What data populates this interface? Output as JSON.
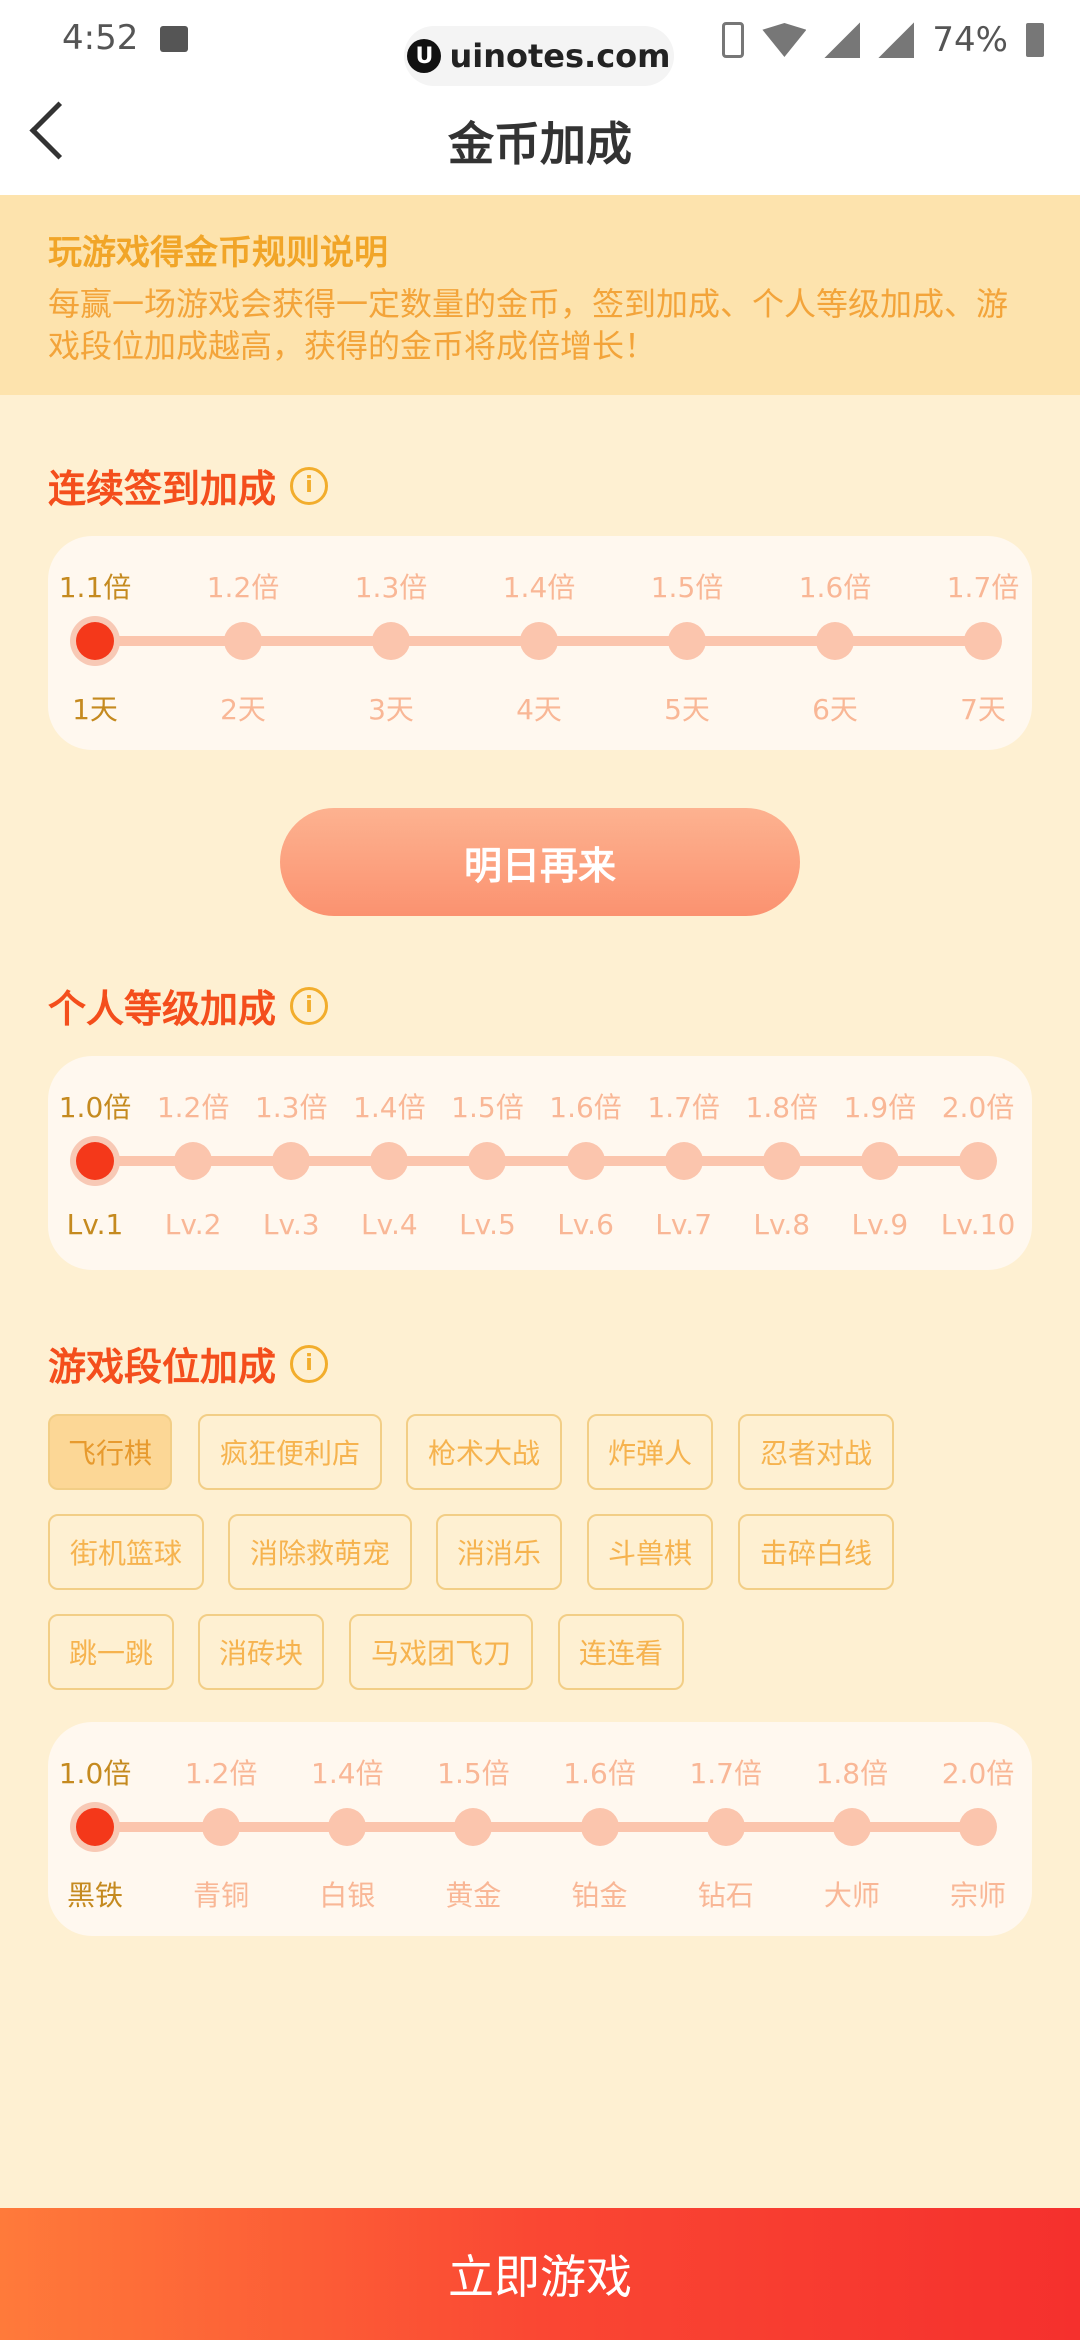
{
  "status": {
    "time": "4:52",
    "battery": "74%",
    "watermark": "uinotes.com",
    "watermark_logo": "U"
  },
  "header": {
    "title": "金币加成"
  },
  "rules": {
    "title": "玩游戏得金币规则说明",
    "text": "每赢一场游戏会获得一定数量的金币，签到加成、个人等级加成、游戏段位加成越高，获得的金币将成倍增长！"
  },
  "checkin": {
    "title": "连续签到加成",
    "info_glyph": "i",
    "active_index": 0,
    "steps": [
      {
        "multiplier": "1.1倍",
        "label": "1天"
      },
      {
        "multiplier": "1.2倍",
        "label": "2天"
      },
      {
        "multiplier": "1.3倍",
        "label": "3天"
      },
      {
        "multiplier": "1.4倍",
        "label": "4天"
      },
      {
        "multiplier": "1.5倍",
        "label": "5天"
      },
      {
        "multiplier": "1.6倍",
        "label": "6天"
      },
      {
        "multiplier": "1.7倍",
        "label": "7天"
      }
    ],
    "button": "明日再来"
  },
  "level": {
    "title": "个人等级加成",
    "info_glyph": "i",
    "active_index": 0,
    "steps": [
      {
        "multiplier": "1.0倍",
        "label": "Lv.1"
      },
      {
        "multiplier": "1.2倍",
        "label": "Lv.2"
      },
      {
        "multiplier": "1.3倍",
        "label": "Lv.3"
      },
      {
        "multiplier": "1.4倍",
        "label": "Lv.4"
      },
      {
        "multiplier": "1.5倍",
        "label": "Lv.5"
      },
      {
        "multiplier": "1.6倍",
        "label": "Lv.6"
      },
      {
        "multiplier": "1.7倍",
        "label": "Lv.7"
      },
      {
        "multiplier": "1.8倍",
        "label": "Lv.8"
      },
      {
        "multiplier": "1.9倍",
        "label": "Lv.9"
      },
      {
        "multiplier": "2.0倍",
        "label": "Lv.10"
      }
    ]
  },
  "rank": {
    "title": "游戏段位加成",
    "info_glyph": "i",
    "selected_game": "飞行棋",
    "games": [
      "飞行棋",
      "疯狂便利店",
      "枪术大战",
      "炸弹人",
      "忍者对战",
      "街机篮球",
      "消除救萌宠",
      "消消乐",
      "斗兽棋",
      "击碎白线",
      "跳一跳",
      "消砖块",
      "马戏团飞刀",
      "连连看"
    ],
    "active_index": 0,
    "steps": [
      {
        "multiplier": "1.0倍",
        "label": "黑铁"
      },
      {
        "multiplier": "1.2倍",
        "label": "青铜"
      },
      {
        "multiplier": "1.4倍",
        "label": "白银"
      },
      {
        "multiplier": "1.5倍",
        "label": "黄金"
      },
      {
        "multiplier": "1.6倍",
        "label": "铂金"
      },
      {
        "multiplier": "1.7倍",
        "label": "钻石"
      },
      {
        "multiplier": "1.8倍",
        "label": "大师"
      },
      {
        "multiplier": "2.0倍",
        "label": "宗师"
      }
    ]
  },
  "cta": {
    "label": "立即游戏"
  },
  "colors": {
    "accent": "#f44e1c",
    "gold": "#f2ad2c",
    "cta": "#fa4733"
  }
}
